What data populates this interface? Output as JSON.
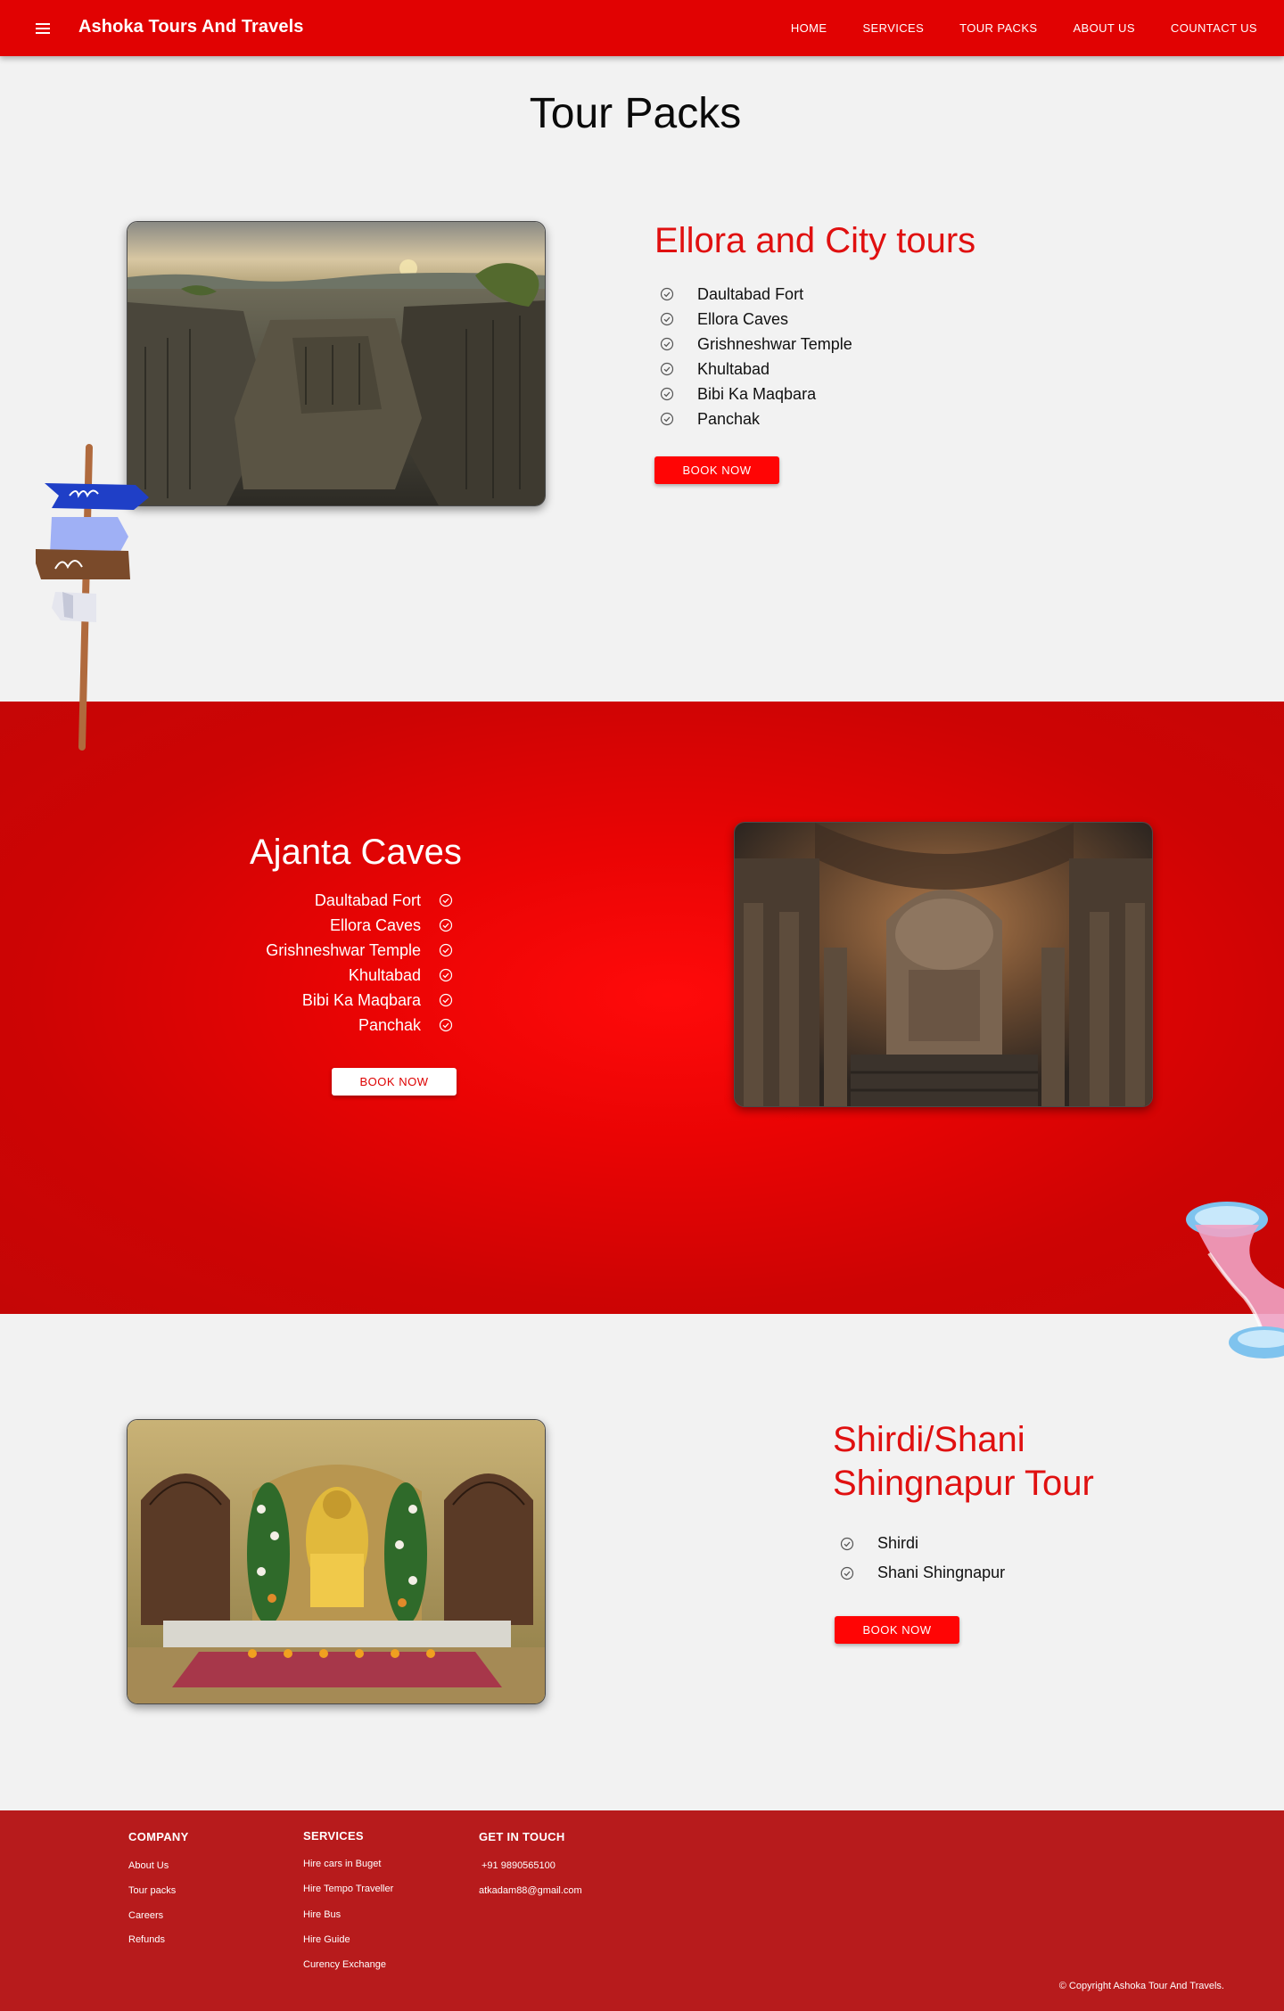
{
  "header": {
    "brand": "Ashoka Tours And Travels",
    "nav": [
      "HOME",
      "SERVICES",
      "TOUR PACKS",
      "ABOUT US",
      "COUNTACT US"
    ]
  },
  "page_title": "Tour Packs",
  "tours": [
    {
      "title": "Ellora and City tours",
      "items": [
        "Daultabad Fort",
        "Ellora Caves",
        "Grishneshwar Temple",
        "Khultabad",
        "Bibi Ka Maqbara",
        "Panchak"
      ],
      "button": "BOOK NOW"
    },
    {
      "title": "Ajanta Caves",
      "items": [
        "Daultabad Fort",
        "Ellora Caves",
        "Grishneshwar Temple",
        "Khultabad",
        "Bibi Ka Maqbara",
        "Panchak"
      ],
      "button": "BOOK NOW"
    },
    {
      "title_line1": "Shirdi/Shani",
      "title_line2": "Shingnapur Tour",
      "items": [
        "Shirdi",
        "Shani Shingnapur"
      ],
      "button": "BOOK NOW"
    }
  ],
  "footer": {
    "company": {
      "heading": "COMPANY",
      "links": [
        "About Us",
        "Tour packs",
        "Careers",
        "Refunds"
      ]
    },
    "services": {
      "heading": "SERVICES",
      "links": [
        "Hire cars in Buget",
        "Hire Tempo Traveller",
        "Hire Bus",
        "Hire Guide",
        "Curency Exchange"
      ]
    },
    "contact": {
      "heading": "GET IN TOUCH",
      "phone": "+91 9890565100",
      "email": "atkadam88@gmail.com"
    },
    "copyright": "© Copyright Ashoka Tour And Travels."
  },
  "colors": {
    "primary_red": "#e10202",
    "footer_red": "#b71b1c",
    "accent_red": "#e01010"
  }
}
